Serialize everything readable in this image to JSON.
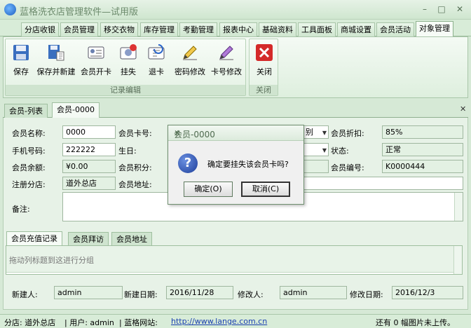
{
  "window": {
    "title": "蓝格洗衣店管理软件—试用版",
    "min": "–",
    "max": "□",
    "close": "✕"
  },
  "menu_tabs": [
    "分店收银",
    "会员管理",
    "移交衣物",
    "库存管理",
    "考勤管理",
    "报表中心",
    "基础资料",
    "工具面板",
    "商城设置",
    "会员活动",
    "对象管理"
  ],
  "ribbon": {
    "groups": [
      {
        "label": "记录编辑",
        "buttons": [
          "保存",
          "保存并新建",
          "会员开卡",
          "挂失",
          "退卡",
          "密码修改",
          "卡号修改"
        ]
      },
      {
        "label": "关闭",
        "buttons": [
          "关闭"
        ]
      }
    ],
    "icons": [
      "floppy-icon",
      "save-new-icon",
      "id-card-icon",
      "lost-card-icon",
      "refund-card-icon",
      "pencil-icon",
      "pencil-icon",
      "close-x-icon"
    ]
  },
  "doc_tabs": [
    "会员-列表",
    "会员-0000"
  ],
  "form": {
    "member_name_label": "会员名称:",
    "member_name": "0000",
    "card_no_label": "会员卡号:",
    "gender_partial": "别",
    "discount_label": "会员折扣:",
    "discount": "85%",
    "phone_label": "手机号码:",
    "phone": "222222",
    "birthday_label": "生日:",
    "status_label": "状态:",
    "status": "正常",
    "balance_label": "会员余额:",
    "balance": "¥0.00",
    "points_label": "会员积分:",
    "member_no_label": "会员编号:",
    "member_no": "K0000444",
    "store_label": "注册分店:",
    "store": "道外总店",
    "address_label": "会员地址:",
    "remark_label": "备注:"
  },
  "sub_tabs": [
    "会员充值记录",
    "会员拜访",
    "会员地址"
  ],
  "grid": {
    "group_hint": "拖动列标题到这进行分组"
  },
  "footer": {
    "creator_label": "新建人:",
    "creator": "admin",
    "created_date_label": "新建日期:",
    "created_date": "2016/11/28",
    "modifier_label": "修改人:",
    "modifier": "admin",
    "modified_date_label": "修改日期:",
    "modified_date": "2016/12/3"
  },
  "statusbar": {
    "branch": "分店: 道外总店",
    "user": "| 用户: admin",
    "site_label": "| 蓝格网站:",
    "site_url": "http://www.lange.com.cn",
    "upload": "还有 0 幅图片未上传。"
  },
  "dialog": {
    "title": "会员-0000",
    "close": "✕",
    "message": "确定要挂失该会员卡吗?",
    "ok": "确定(O)",
    "cancel": "取消(C)"
  }
}
